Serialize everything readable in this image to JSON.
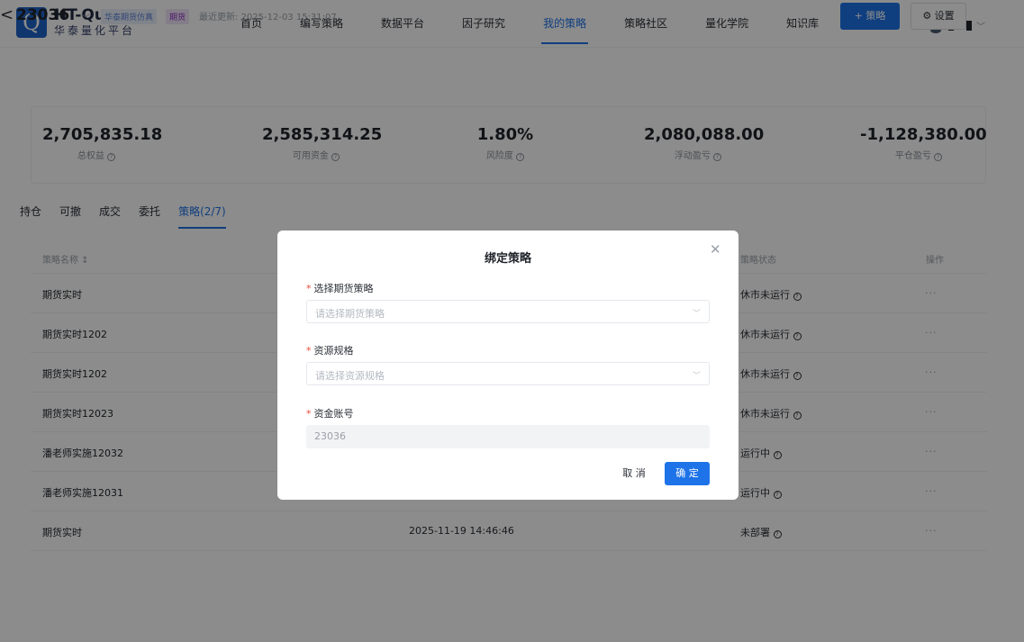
{
  "header": {
    "logo_letter": "Q",
    "logo_title": "HT-Quant",
    "logo_subtitle": "华泰量化平台",
    "nav": [
      {
        "label": "首页",
        "active": false
      },
      {
        "label": "编写策略",
        "active": false
      },
      {
        "label": "数据平台",
        "active": false
      },
      {
        "label": "因子研究",
        "active": false
      },
      {
        "label": "我的策略",
        "active": true
      },
      {
        "label": "策略社区",
        "active": false
      },
      {
        "label": "量化学院",
        "active": false
      },
      {
        "label": "知识库",
        "active": false
      }
    ],
    "user_icons": [
      "avatar-icon",
      "chevron-down-icon"
    ]
  },
  "subheader": {
    "back": "<",
    "account": "23036",
    "tag_sim": "华泰期货仿真",
    "tag_futures": "期货",
    "updated": "最近更新: 2025-12-03 15:31:07",
    "add_strategy": "+ 策略",
    "settings": "⚙ 设置"
  },
  "stats": [
    {
      "value": "2,705,835.18",
      "label": "总权益"
    },
    {
      "value": "2,585,314.25",
      "label": "可用资金"
    },
    {
      "value": "1.80%",
      "label": "风险度"
    },
    {
      "value": "2,080,088.00",
      "label": "浮动盈亏"
    },
    {
      "value": "-1,128,380.00",
      "label": "平仓盈亏"
    }
  ],
  "tabs": [
    {
      "label": "持仓",
      "active": false
    },
    {
      "label": "可撤",
      "active": false
    },
    {
      "label": "成交",
      "active": false
    },
    {
      "label": "委托",
      "active": false
    },
    {
      "label": "策略(2/7)",
      "active": true
    }
  ],
  "table": {
    "headers": {
      "name": "策略名称 ↕",
      "status": "策略状态",
      "op": "操作"
    },
    "rows": [
      {
        "name": "期货实时",
        "time": "",
        "status": "休市未运行",
        "op": "···"
      },
      {
        "name": "期货实时1202",
        "time": "",
        "status": "休市未运行",
        "op": "···"
      },
      {
        "name": "期货实时1202",
        "time": "",
        "status": "休市未运行",
        "op": "···"
      },
      {
        "name": "期货实时12023",
        "time": "",
        "status": "休市未运行",
        "op": "···"
      },
      {
        "name": "潘老师实施12032",
        "time": "",
        "status": "运行中",
        "op": "···"
      },
      {
        "name": "潘老师实施12031",
        "time": "",
        "status": "运行中",
        "op": "···"
      },
      {
        "name": "期货实时",
        "time": "2025-11-19 14:46:46",
        "status": "未部署",
        "op": "···"
      }
    ]
  },
  "modal": {
    "title": "绑定策略",
    "close": "✕",
    "strategy_label": "选择期货策略",
    "strategy_placeholder": "请选择期货策略",
    "resource_label": "资源规格",
    "resource_placeholder": "请选择资源规格",
    "account_label": "资金账号",
    "account_value": "23036",
    "cancel": "取 消",
    "confirm": "确 定",
    "required_mark": "*"
  },
  "colors": {
    "accent": "#1e73e8",
    "brand": "#1e63c9",
    "required": "#e84a3a"
  }
}
